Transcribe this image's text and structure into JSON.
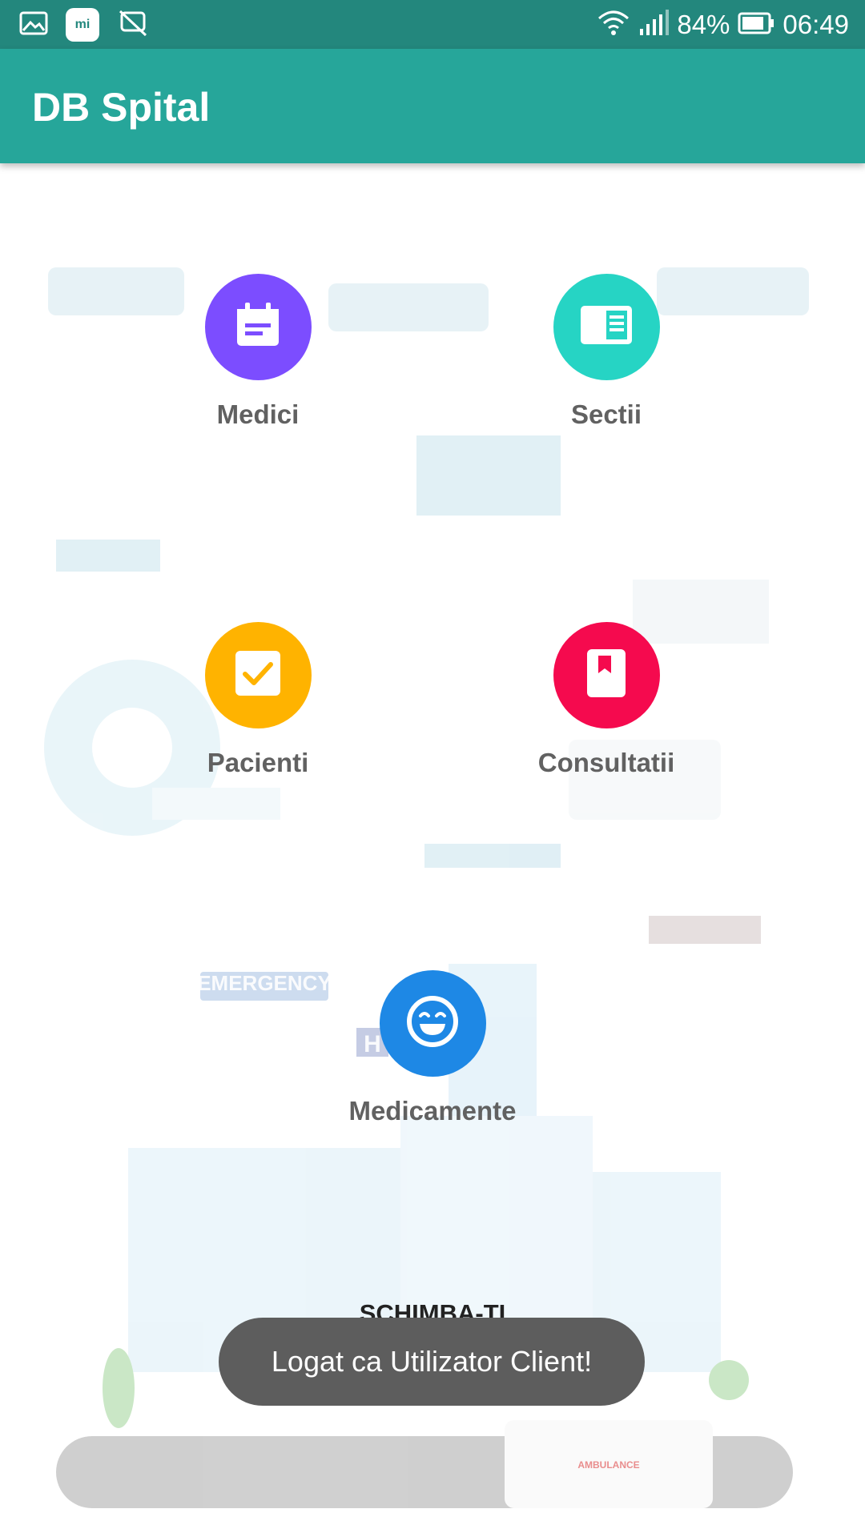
{
  "status_bar": {
    "icons_left": [
      "gallery-icon",
      "mi-icon",
      "screen-rotation-off-icon"
    ],
    "mi_label": "mi",
    "battery": "84%",
    "time": "06:49",
    "icons_right": [
      "wifi-icon",
      "signal-icon",
      "battery-icon"
    ]
  },
  "app_bar": {
    "title": "DB Spital"
  },
  "menu": {
    "medici": {
      "label": "Medici",
      "color": "#7c4dff",
      "icon": "calendar-icon"
    },
    "sectii": {
      "label": "Sectii",
      "color": "#26d4c4",
      "icon": "panel-icon"
    },
    "pacienti": {
      "label": "Pacienti",
      "color": "#ffb300",
      "icon": "checkbox-icon"
    },
    "consultatii": {
      "label": "Consultatii",
      "color": "#f50a4e",
      "icon": "bookmark-icon"
    },
    "medicamente": {
      "label": "Medicamente",
      "color": "#1e88e5",
      "icon": "smiley-icon"
    }
  },
  "switch_user": {
    "label": "SCHIMBA-TI UTILIZATORUL"
  },
  "illustration": {
    "sign": "EMERGENCY",
    "h_sign": "H",
    "ambulance": "AMBULANCE"
  },
  "toast": {
    "message": "Logat ca Utilizator Client!"
  }
}
